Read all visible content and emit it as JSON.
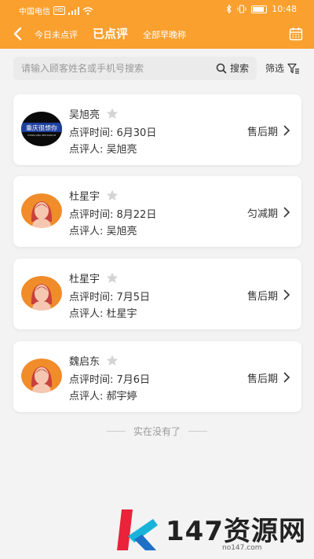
{
  "status_bar": {
    "carrier": "中国电信",
    "hd": "HD",
    "time": "10:48",
    "battery_level": 0.85
  },
  "header": {
    "tabs": [
      {
        "label": "今日未点评"
      },
      {
        "label": "已点评"
      },
      {
        "label": "全部早晚称"
      }
    ],
    "active_tab": "已点评",
    "background_color": "#f9a02f"
  },
  "search": {
    "placeholder": "请输入顾客姓名或手机号搜索",
    "value": "",
    "button_label": "搜索"
  },
  "filter": {
    "label": "筛选"
  },
  "cards": [
    {
      "name": "吴旭亮",
      "review_time": "点评时间: 6月30日",
      "reviewer": "点评人: 吴旭亮",
      "status": "售后期",
      "avatar": "photo",
      "avatar_caption": "重庆很想你",
      "avatar_subcaption": "CHONG QING HEN XIANG NI"
    },
    {
      "name": "杜星宇",
      "review_time": "点评时间: 8月22日",
      "reviewer": "点评人: 吴旭亮",
      "status": "匀减期",
      "avatar": "default-female"
    },
    {
      "name": "杜星宇",
      "review_time": "点评时间: 7月5日",
      "reviewer": "点评人: 杜星宇",
      "status": "售后期",
      "avatar": "default-female"
    },
    {
      "name": "魏启东",
      "review_time": "点评时间: 7月6日",
      "reviewer": "点评人: 郝宇婷",
      "status": "售后期",
      "avatar": "default-female"
    }
  ],
  "end_text": "实在没有了",
  "watermark": {
    "text": "147资源网",
    "url": "no147.com"
  }
}
